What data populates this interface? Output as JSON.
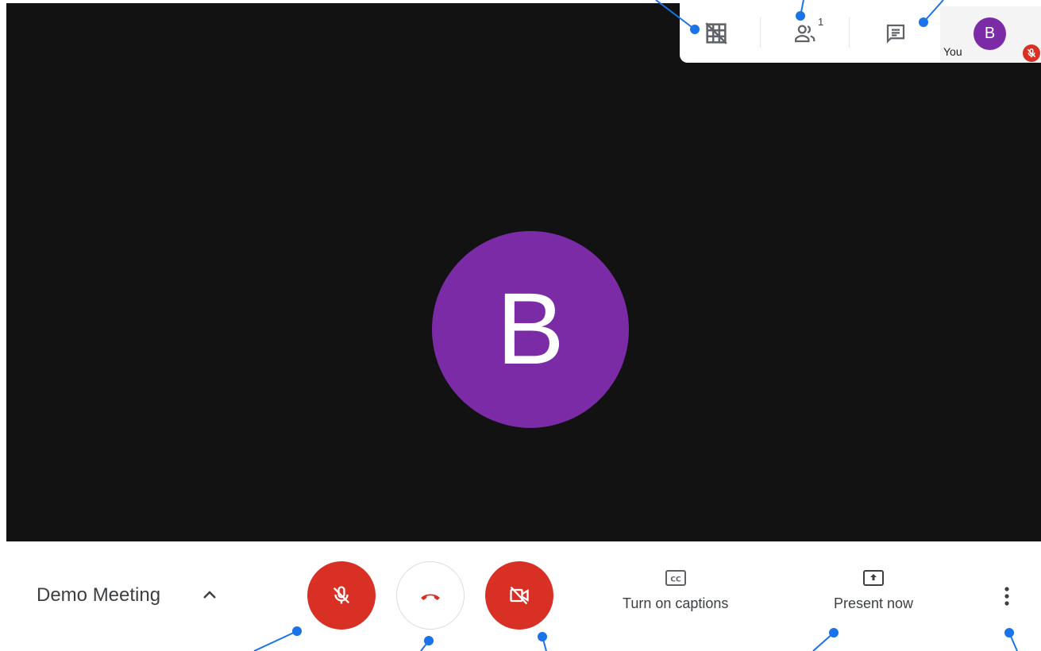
{
  "app": {
    "accent_color": "#7b2ba5",
    "danger_color": "#d93025",
    "annotation_color": "#1a73e8"
  },
  "stage": {
    "background": "#121212",
    "main_participant": {
      "initial": "B"
    }
  },
  "top_bar": {
    "buttons": [
      {
        "icon": "tiled-layout-off-icon"
      },
      {
        "icon": "people-icon",
        "count": "1"
      },
      {
        "icon": "chat-icon"
      }
    ],
    "self_view": {
      "name": "You",
      "initial": "B",
      "muted_icon": "mic-off-icon"
    }
  },
  "bottom_bar": {
    "meeting_title": "Demo Meeting",
    "title_toggle_icon": "chevron-up-icon",
    "controls": [
      {
        "icon": "mic-off-icon",
        "state": "muted"
      },
      {
        "icon": "hang-up-icon"
      },
      {
        "icon": "camera-off-icon",
        "state": "off"
      }
    ],
    "captions": {
      "icon": "closed-captions-icon",
      "label": "Turn on captions"
    },
    "present": {
      "icon": "present-screen-icon",
      "label": "Present now"
    },
    "more_icon": "more-vertical-icon"
  }
}
